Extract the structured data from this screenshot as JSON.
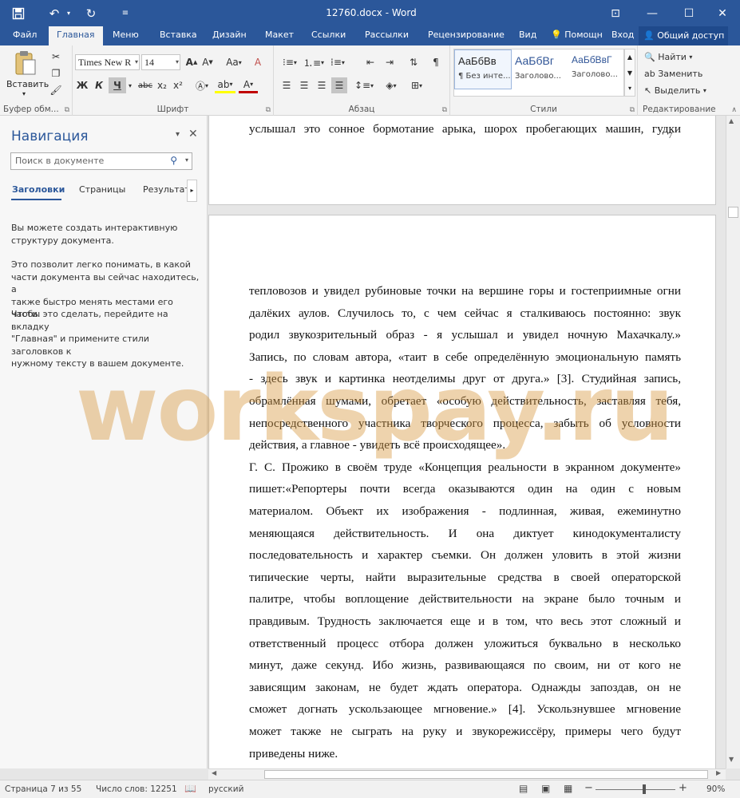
{
  "window": {
    "title": "12760.docx - Word"
  },
  "quick_access": {
    "save_icon": "save-icon",
    "undo_icon": "undo-icon",
    "redo_icon": "redo-icon",
    "customize_icon": "customize-icon"
  },
  "window_controls": {
    "ribbon_display_icon": "ribbon-display-icon",
    "minimize_icon": "minimize-icon",
    "maximize_icon": "maximize-icon",
    "close_icon": "close-icon"
  },
  "tabs": {
    "file": "Файл",
    "home": "Главная",
    "menu": "Меню",
    "insert": "Вставка",
    "design": "Дизайн",
    "layout": "Макет",
    "references": "Ссылки",
    "mailings": "Рассылки",
    "review": "Рецензирование",
    "view": "Вид",
    "help": "Помощн",
    "signin": "Вход",
    "share": "Общий доступ"
  },
  "ribbon": {
    "clipboard": {
      "label": "Буфер обм...",
      "paste": "Вставить"
    },
    "font": {
      "label": "Шрифт",
      "name": "Times New R",
      "size": "14",
      "bold": "Ж",
      "italic": "К",
      "underline": "Ч",
      "strike": "abc",
      "subscript": "x₂",
      "superscript": "x²",
      "aa": "Aa"
    },
    "paragraph": {
      "label": "Абзац"
    },
    "styles": {
      "label": "Стили",
      "items": [
        {
          "preview": "АаБбВв",
          "name": "¶ Без инте..."
        },
        {
          "preview": "АаБбВг",
          "name": "Заголово..."
        },
        {
          "preview": "АаБбВвГ",
          "name": "Заголово..."
        }
      ]
    },
    "editing": {
      "label": "Редактирование",
      "find": "Найти",
      "replace": "Заменить",
      "select": "Выделить"
    }
  },
  "navigation": {
    "title": "Навигация",
    "search_placeholder": "Поиск в документе",
    "tabs": [
      "Заголовки",
      "Страницы",
      "Результат"
    ],
    "paragraphs": [
      [
        "Вы можете создать интерактивную",
        "структуру документа."
      ],
      [
        "Это позволит легко понимать, в какой",
        "части документа вы сейчас находитесь, а",
        "также быстро менять местами его части."
      ],
      [
        "Чтобы это сделать, перейдите на вкладку",
        "\"Главная\" и примените стили заголовков к",
        "нужному тексту в вашем документе."
      ]
    ]
  },
  "document": {
    "page_number": "7",
    "top_line": "услышал это сонное бормотание арыка, шорох пробегающих машин, гудки",
    "lines": [
      "тепловозов и увидел рубиновые точки на вершине горы и гостеприимные огни",
      "далёких аулов. Случилось то, с чем сейчас я сталкиваюсь постоянно: звук",
      "родил звукозрительный образ - я услышал и увидел ночную Махачкалу.»",
      "Запись, по словам автора, «таит в себе определённую эмоциональную память",
      "- здесь звук и картинка неотделимы друг от друга.» [3]. Студийная запись,",
      "обрамлённая шумами, обретает «особую действительность, заставляя тебя,",
      "непосредственного участника творческого процесса, забыть об условности",
      "действия, а главное - увидеть всё происходящее».",
      "Г. С. Прожико в своём труде «Концепция реальности в экранном документе»",
      "пишет:«Репортеры почти всегда оказываются один на один с новым",
      "материалом. Объект их изображения - подлинная, живая, ежеминутно",
      "меняющаяся действительность. И она диктует кинодокументалисту",
      "последовательность и характер съемки. Он должен уловить в этой жизни",
      "типические черты, найти выразительные средства в своей операторской",
      "палитре, чтобы воплощение действительности на экране было точным и",
      "правдивым. Трудность заключается еще и в том, что весь этот сложный и",
      "ответственный процесс отбора должен уложиться буквально в несколько",
      "минут, даже секунд. Ибо жизнь, развивающаяся по своим, ни от кого не",
      "зависящим законам, не будет ждать оператора. Однажды запоздав, он не",
      "сможет догнать ускользающее мгновение.» [4]. Ускользнувшее мгновение",
      "может также не сыграть на руку и звукорежиссёру, примеры чего будут",
      "приведены ниже."
    ],
    "watermark": "workspay.ru"
  },
  "status": {
    "page": "Страница 7 из 55",
    "words": "Число слов: 12251",
    "language": "русский",
    "zoom": "90%"
  },
  "colors": {
    "accent": "#2b579a",
    "watermark": "#d6963c"
  }
}
